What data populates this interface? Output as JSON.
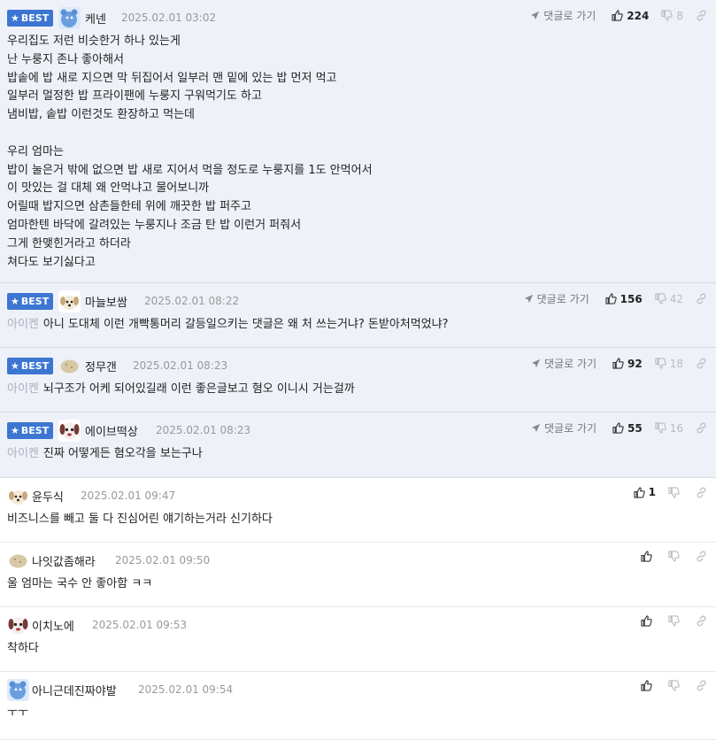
{
  "labels": {
    "best": "BEST",
    "reply": "댓글로 가기"
  },
  "comments": [
    {
      "best": true,
      "avatar": "blue-bear-icon",
      "nick": "케넨",
      "date": "2025.02.01 03:02",
      "up": "224",
      "down": "8",
      "mention": "",
      "text": "우리집도 저런 비슷한거 하나 있는게\n난 누룽지 존나 좋아해서\n밥솥에 밥 새로 지으면 막 뒤집어서 일부러 맨 밑에 있는 밥 먼저 먹고\n일부러 멀정한 밥 프라이팬에 누룽지 구워먹기도 하고\n냄비밥, 솥밥 이런것도 환장하고 먹는데\n\n우리 엄마는\n밥이 눌은거 밖에 없으면 밥 새로 지어서 먹을 정도로 누룽지를 1도 안먹어서\n이 맛있는 걸 대체 왜 안먹냐고 물어보니까\n어릴때 밥지으면 삼촌들한테 위에 깨끗한 밥 퍼주고\n엄마한텐 바닥에 갈려있는 누룽지나 조금 탄 밥 이런거 퍼줘서\n그게 한맺힌거라고 하더라\n쳐다도 보기싫다고"
    },
    {
      "best": true,
      "avatar": "puppy-icon",
      "nick": "마늘보쌈",
      "date": "2025.02.01 08:22",
      "up": "156",
      "down": "42",
      "mention": "아이켄",
      "text": "아니 도대체 이런 개빡통머리 갈등일으키는 댓글은 왜 처 쓰는거냐? 돈받아처먹었냐?"
    },
    {
      "best": true,
      "avatar": "potato-icon",
      "nick": "정무갠",
      "date": "2025.02.01 08:23",
      "up": "92",
      "down": "18",
      "mention": "아이켄",
      "text": "뇌구조가 어케 되어있길래 이런 좋은글보고 혐오 이니시 거는걸까"
    },
    {
      "best": true,
      "avatar": "dog-face-icon",
      "nick": "에이브떡상",
      "date": "2025.02.01 08:23",
      "up": "55",
      "down": "16",
      "mention": "아이켄",
      "text": "진짜 어떻게든 혐오각을 보는구나"
    },
    {
      "best": false,
      "avatar": "puppy-icon",
      "nick": "윤두식",
      "date": "2025.02.01 09:47",
      "up": "1",
      "down": "",
      "mention": "",
      "text": "비즈니스를 빼고 둘 다 진심어린 얘기하는거라 신기하다"
    },
    {
      "best": false,
      "avatar": "potato-icon",
      "nick": "나잇값좀해라",
      "date": "2025.02.01 09:50",
      "up": "",
      "down": "",
      "mention": "",
      "text": "울 엄마는 국수 안 좋아함 ㅋㅋ"
    },
    {
      "best": false,
      "avatar": "dog-face-icon",
      "nick": "이치노에",
      "date": "2025.02.01 09:53",
      "up": "",
      "down": "",
      "mention": "",
      "text": "착하다"
    },
    {
      "best": false,
      "avatar": "blue-bear-icon",
      "nick": "아니근데진짜야발",
      "date": "2025.02.01 09:54",
      "up": "",
      "down": "",
      "mention": "",
      "text": "ㅜㅜ"
    }
  ]
}
